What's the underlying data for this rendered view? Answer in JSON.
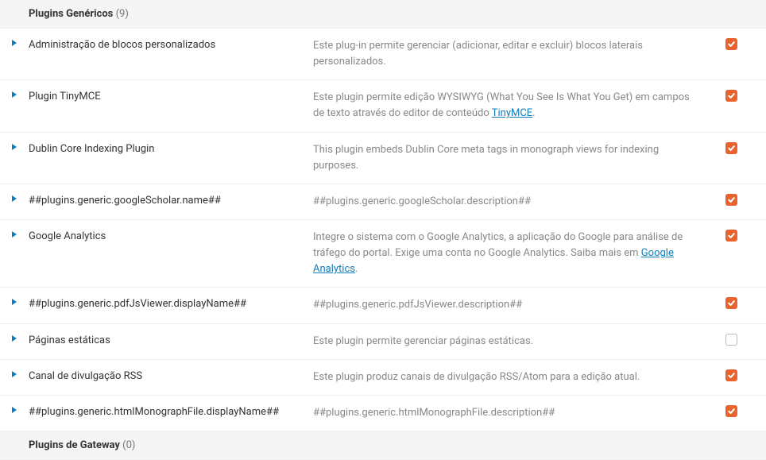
{
  "sections": [
    {
      "title": "Plugins Genéricos",
      "count": "(9)",
      "plugins": [
        {
          "name": "Administração de blocos personalizados",
          "description": "Este plug-in permite gerenciar (adicionar, editar e excluir) blocos laterais personalizados.",
          "enabled": true
        },
        {
          "name": "Plugin TinyMCE",
          "description_html": "Este plugin permite edição WYSIWYG (What You See Is What You Get) em campos de texto através do editor de conteúdo <a href='#'>TinyMCE</a>.",
          "enabled": true
        },
        {
          "name": "Dublin Core Indexing Plugin",
          "description": "This plugin embeds Dublin Core meta tags in monograph views for indexing purposes.",
          "enabled": true
        },
        {
          "name": "##plugins.generic.googleScholar.name##",
          "description": "##plugins.generic.googleScholar.description##",
          "enabled": true
        },
        {
          "name": "Google Analytics",
          "description_html": "Integre o sistema com o Google Analytics, a aplicação do Google para análise de tráfego do portal. Exige uma conta no Google Analytics. Saiba mais em <a href='#'>Google Analytics</a>.",
          "enabled": true
        },
        {
          "name": "##plugins.generic.pdfJsViewer.displayName##",
          "description": "##plugins.generic.pdfJsViewer.description##",
          "enabled": true
        },
        {
          "name": "Páginas estáticas",
          "description": "Este plugin permite gerenciar páginas estáticas.",
          "enabled": false
        },
        {
          "name": "Canal de divulgação RSS",
          "description": "Este plugin produz canais de divulgação RSS/Atom para a edição atual.",
          "enabled": true
        },
        {
          "name": "##plugins.generic.htmlMonographFile.displayName##",
          "description": "##plugins.generic.htmlMonographFile.description##",
          "enabled": true
        }
      ]
    },
    {
      "title": "Plugins de Gateway",
      "count": "(0)",
      "plugins": []
    }
  ]
}
